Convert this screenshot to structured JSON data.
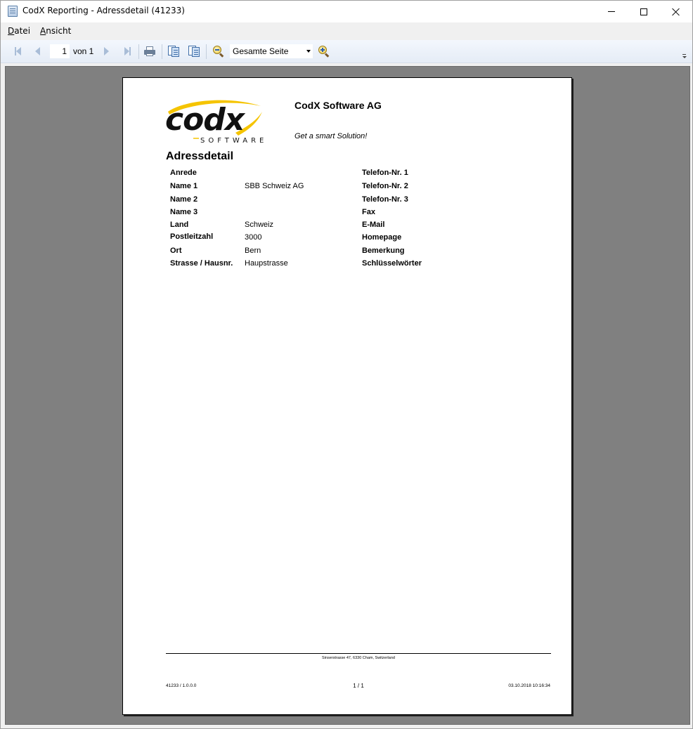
{
  "window": {
    "title": "CodX Reporting - Adressdetail (41233)"
  },
  "menu": {
    "items": [
      "Datei",
      "Ansicht"
    ]
  },
  "toolbar": {
    "current_page": "1",
    "page_of_label": "von 1",
    "zoom_value": "Gesamte Seite",
    "icons": [
      "first-page-icon",
      "prev-page-icon",
      "next-page-icon",
      "last-page-icon",
      "printer-icon",
      "single-page-icon",
      "multi-page-icon",
      "zoom-out-icon",
      "zoom-in-icon"
    ]
  },
  "report": {
    "logo_word": "codx",
    "logo_sub": "SOFTWARE",
    "company": "CodX Software AG",
    "tagline": "Get a smart Solution!",
    "title": "Adressdetail",
    "left_fields": [
      {
        "label": "Anrede",
        "value": ""
      },
      {
        "label": "Name 1",
        "value": "SBB Schweiz AG"
      },
      {
        "label": "Name 2",
        "value": ""
      },
      {
        "label": "Name 3",
        "value": ""
      },
      {
        "label": "Land",
        "value": "Schweiz"
      },
      {
        "label": "Postleitzahl",
        "value": "3000"
      },
      {
        "label": "Ort",
        "value": "Bern"
      },
      {
        "label": "Strasse / Hausnr.",
        "value": "Haupstrasse"
      }
    ],
    "right_fields": [
      {
        "label": "Telefon-Nr. 1"
      },
      {
        "label": "Telefon-Nr. 2"
      },
      {
        "label": "Telefon-Nr. 3"
      },
      {
        "label": "Fax"
      },
      {
        "label": "E-Mail"
      },
      {
        "label": "Homepage"
      },
      {
        "label": "Bemerkung"
      },
      {
        "label": "Schlüsselwörter"
      }
    ],
    "footer": {
      "address": "Sinserstrasse 47, 6330 Cham, Switzerland",
      "report_id": "41233 / 1.0.0.0",
      "pages": "1 / 1",
      "printed": "03.10.2018 10:16:34"
    }
  },
  "colors": {
    "preview_background": "#808080",
    "logo_yellow": "#f5c400",
    "toolbar_icon": "#a9bdd7"
  }
}
